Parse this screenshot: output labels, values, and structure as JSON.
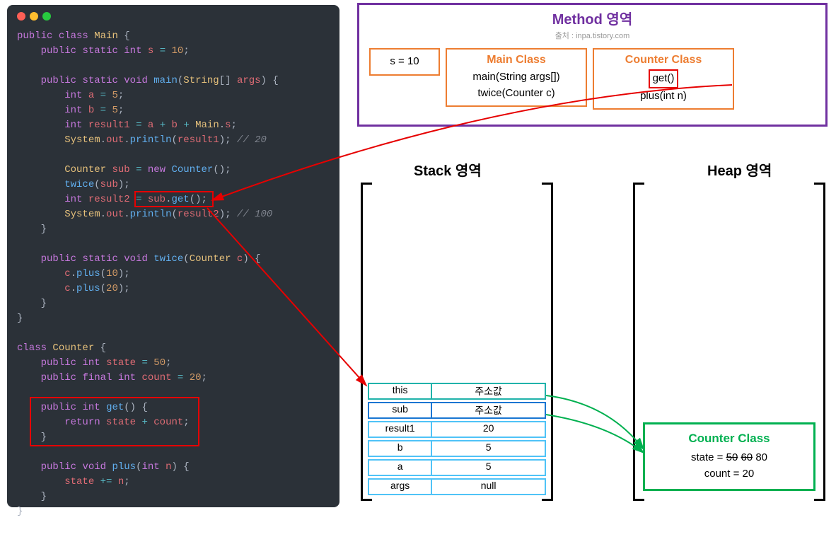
{
  "code": {
    "class_main": "Main",
    "class_counter": "Counter",
    "s_value": "10",
    "a_value": "5",
    "b_value": "5",
    "result1_comment": "// 20",
    "result2_comment": "// 100",
    "state_init": "50",
    "count_init": "20",
    "plus1": "10",
    "plus2": "20"
  },
  "method": {
    "title": "Method 영역",
    "source": "출처 : inpa.tistory.com",
    "s_box": "s = 10",
    "main_title": "Main Class",
    "main_item1": "main(String args[])",
    "main_item2": "twice(Counter c)",
    "counter_title": "Counter Class",
    "counter_get": "get()",
    "counter_plus": "plus(int n)"
  },
  "stack": {
    "title": "Stack 영역",
    "rows": [
      {
        "k": "this",
        "v": "주소값",
        "cls": "teal"
      },
      {
        "k": "sub",
        "v": "주소값",
        "cls": "blue"
      },
      {
        "k": "result1",
        "v": "20",
        "cls": "blue2"
      },
      {
        "k": "b",
        "v": "5",
        "cls": "blue2"
      },
      {
        "k": "a",
        "v": "5",
        "cls": "blue2"
      },
      {
        "k": "args",
        "v": "null",
        "cls": "blue2"
      }
    ]
  },
  "heap": {
    "title": "Heap 영역",
    "box_title": "Counter Class",
    "state_label": "state = ",
    "state_s1": "50",
    "state_s2": "60",
    "state_cur": "80",
    "count": "count = 20"
  }
}
